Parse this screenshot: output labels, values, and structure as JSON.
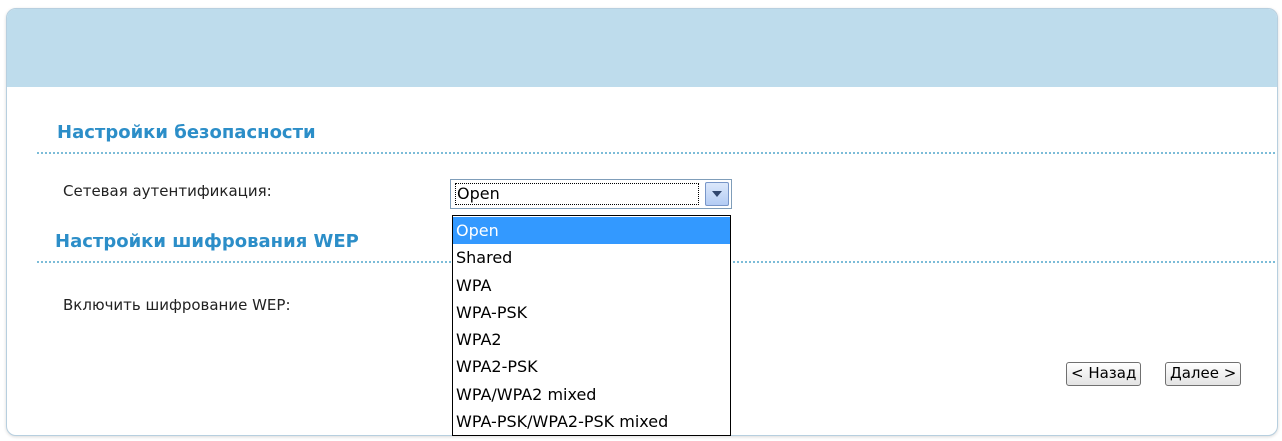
{
  "security_section": {
    "title": "Настройки безопасности",
    "network_auth_label": "Сетевая аутентификация:",
    "auth_select": {
      "selected_value": "Open",
      "options": [
        "Open",
        "Shared",
        "WPA",
        "WPA-PSK",
        "WPA2",
        "WPA2-PSK",
        "WPA/WPA2 mixed",
        "WPA-PSK/WPA2-PSK mixed"
      ],
      "highlighted_option": "Open"
    }
  },
  "wep_section": {
    "title": "Настройки шифрования WEP",
    "enable_wep_label": "Включить шифрование WEP:"
  },
  "buttons": {
    "back_label": "< Назад",
    "next_label": "Далее >"
  },
  "colors": {
    "header_background": "#bedcec",
    "section_title": "#2c8ec8",
    "dotted_separator": "#7cbcd8",
    "selected_option_background": "#3399ff"
  }
}
